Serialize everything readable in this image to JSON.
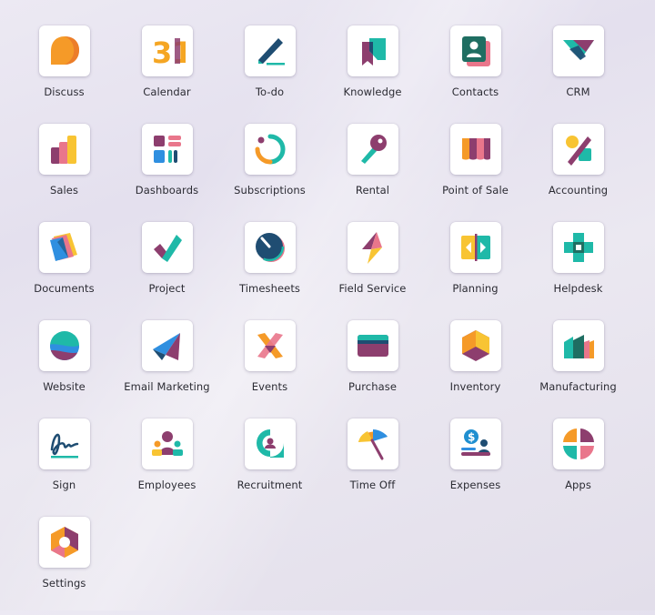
{
  "apps": [
    {
      "id": "discuss",
      "label": "Discuss",
      "icon": "discuss-icon"
    },
    {
      "id": "calendar",
      "label": "Calendar",
      "icon": "calendar-icon",
      "icon_text": "31"
    },
    {
      "id": "todo",
      "label": "To-do",
      "icon": "todo-icon"
    },
    {
      "id": "knowledge",
      "label": "Knowledge",
      "icon": "knowledge-icon"
    },
    {
      "id": "contacts",
      "label": "Contacts",
      "icon": "contacts-icon"
    },
    {
      "id": "crm",
      "label": "CRM",
      "icon": "crm-icon"
    },
    {
      "id": "sales",
      "label": "Sales",
      "icon": "sales-icon"
    },
    {
      "id": "dashboards",
      "label": "Dashboards",
      "icon": "dashboards-icon"
    },
    {
      "id": "subscriptions",
      "label": "Subscriptions",
      "icon": "subscriptions-icon"
    },
    {
      "id": "rental",
      "label": "Rental",
      "icon": "rental-icon"
    },
    {
      "id": "point-of-sale",
      "label": "Point of Sale",
      "icon": "point-of-sale-icon"
    },
    {
      "id": "accounting",
      "label": "Accounting",
      "icon": "accounting-icon"
    },
    {
      "id": "documents",
      "label": "Documents",
      "icon": "documents-icon"
    },
    {
      "id": "project",
      "label": "Project",
      "icon": "project-icon"
    },
    {
      "id": "timesheets",
      "label": "Timesheets",
      "icon": "timesheets-icon"
    },
    {
      "id": "field-service",
      "label": "Field Service",
      "icon": "field-service-icon"
    },
    {
      "id": "planning",
      "label": "Planning",
      "icon": "planning-icon"
    },
    {
      "id": "helpdesk",
      "label": "Helpdesk",
      "icon": "helpdesk-icon"
    },
    {
      "id": "website",
      "label": "Website",
      "icon": "website-icon"
    },
    {
      "id": "email-marketing",
      "label": "Email Marketing",
      "icon": "email-marketing-icon"
    },
    {
      "id": "events",
      "label": "Events",
      "icon": "events-icon"
    },
    {
      "id": "purchase",
      "label": "Purchase",
      "icon": "purchase-icon"
    },
    {
      "id": "inventory",
      "label": "Inventory",
      "icon": "inventory-icon"
    },
    {
      "id": "manufacturing",
      "label": "Manufacturing",
      "icon": "manufacturing-icon"
    },
    {
      "id": "sign",
      "label": "Sign",
      "icon": "sign-icon"
    },
    {
      "id": "employees",
      "label": "Employees",
      "icon": "employees-icon"
    },
    {
      "id": "recruitment",
      "label": "Recruitment",
      "icon": "recruitment-icon"
    },
    {
      "id": "time-off",
      "label": "Time Off",
      "icon": "time-off-icon"
    },
    {
      "id": "expenses",
      "label": "Expenses",
      "icon": "expenses-icon",
      "icon_text": "$"
    },
    {
      "id": "apps",
      "label": "Apps",
      "icon": "apps-icon"
    },
    {
      "id": "settings",
      "label": "Settings",
      "icon": "settings-icon"
    }
  ],
  "colors": {
    "orange": "#f59a28",
    "plum": "#8d3e6e",
    "teal": "#1fb9a8",
    "navy": "#1f4d72",
    "pink": "#e9768b",
    "yellow": "#f8c433",
    "blue": "#2f8fe0",
    "label_text": "#2b2b33"
  }
}
